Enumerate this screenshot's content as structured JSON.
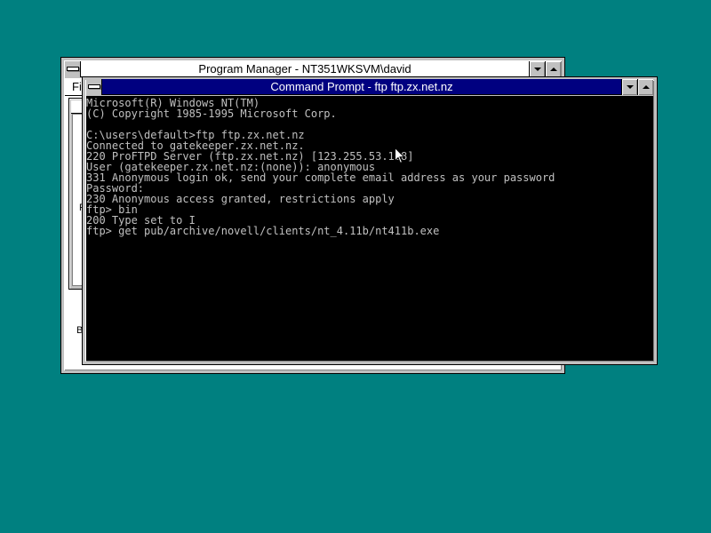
{
  "desktop": {
    "background": "#008080"
  },
  "program_manager": {
    "title": "Program Manager - NT351WKSVM\\david",
    "menu_first": "Fi",
    "group_stub_letters": [
      "F",
      "B"
    ]
  },
  "command_prompt": {
    "title": "Command Prompt - ftp ftp.zx.net.nz",
    "lines": [
      "Microsoft(R) Windows NT(TM)",
      "(C) Copyright 1985-1995 Microsoft Corp.",
      "",
      "C:\\users\\default>ftp ftp.zx.net.nz",
      "Connected to gatekeeper.zx.net.nz.",
      "220 ProFTPD Server (ftp.zx.net.nz) [123.255.53.188]",
      "User (gatekeeper.zx.net.nz:(none)): anonymous",
      "331 Anonymous login ok, send your complete email address as your password",
      "Password:",
      "230 Anonymous access granted, restrictions apply",
      "ftp> bin",
      "200 Type set to I",
      "ftp> get pub/archive/novell/clients/nt_4.11b/nt411b.exe"
    ]
  },
  "colors": {
    "active_title": "#000080",
    "console_bg": "#000000",
    "console_fg": "#c0c0c0",
    "window_face": "#c0c0c0"
  }
}
